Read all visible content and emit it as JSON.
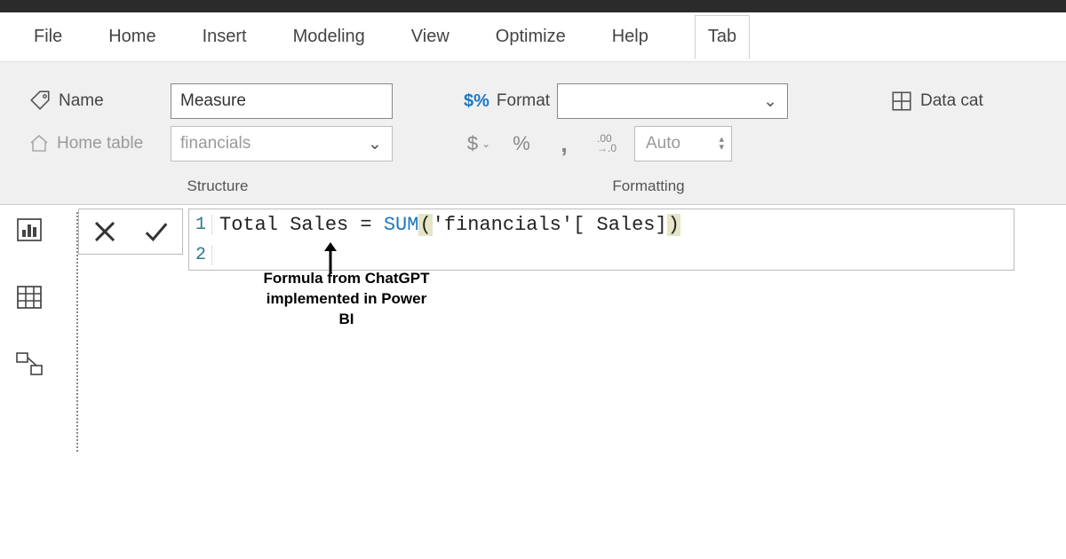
{
  "menu": {
    "items": [
      "File",
      "Home",
      "Insert",
      "Modeling",
      "View",
      "Optimize",
      "Help",
      "Tab"
    ]
  },
  "ribbon": {
    "structure": {
      "caption": "Structure",
      "name_label": "Name",
      "name_value": "Measure",
      "home_table_label": "Home table",
      "home_table_value": "financials"
    },
    "formatting": {
      "caption": "Formatting",
      "format_label": "Format",
      "format_value": "",
      "currency_glyph": "$",
      "percent_glyph": "%",
      "thousand_glyph": ",",
      "decimals_glyph": ".00\n→.0",
      "decimals_value": "Auto"
    },
    "extra": {
      "data_cat_label": "Data cat"
    }
  },
  "formula": {
    "lines": [
      {
        "num": "1",
        "measure_name": "Total Sales",
        "eq": " = ",
        "fn": "SUM",
        "open": "(",
        "arg": "'financials'[ Sales]",
        "close": ")"
      },
      {
        "num": "2"
      }
    ]
  },
  "annotation": {
    "text": "Formula from ChatGPT implemented in Power BI"
  }
}
